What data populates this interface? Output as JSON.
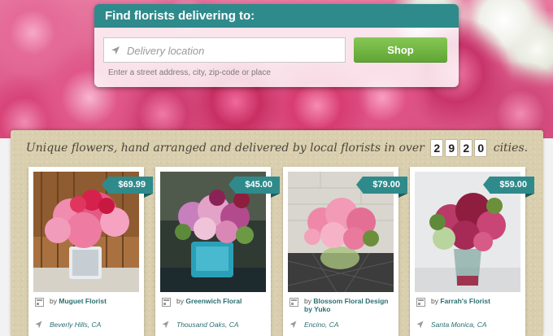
{
  "search": {
    "title": "Find florists delivering to:",
    "placeholder": "Delivery location",
    "button": "Shop",
    "helper": "Enter a street address, city, zip-code or place"
  },
  "tagline": {
    "before": "Unique flowers, hand arranged and delivered by local florists in over",
    "digits": [
      "2",
      "9",
      "2",
      "0"
    ],
    "after": "cities."
  },
  "colors": {
    "accent": "#2f8a8b",
    "button": "#6fb541",
    "board": "#d9cfae"
  },
  "icons": {
    "location": "location-arrow-icon",
    "store": "storefront-icon"
  },
  "cards": [
    {
      "price": "$69.99",
      "by": "by",
      "florist": "Muguet Florist",
      "city": "Beverly Hills, CA"
    },
    {
      "price": "$45.00",
      "by": "by",
      "florist": "Greenwich Floral",
      "city": "Thousand Oaks, CA"
    },
    {
      "price": "$79.00",
      "by": "by",
      "florist": "Blossom Floral Design by Yuko",
      "city": "Encino, CA"
    },
    {
      "price": "$59.00",
      "by": "by",
      "florist": "Farrah's Florist",
      "city": "Santa Monica, CA"
    }
  ]
}
